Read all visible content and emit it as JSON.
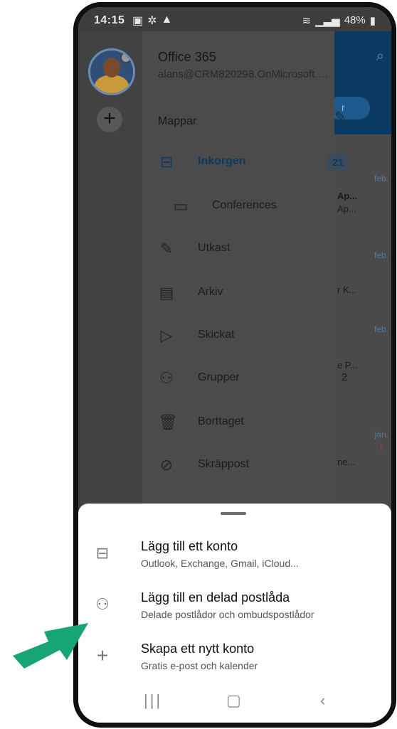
{
  "status": {
    "time": "14:15",
    "battery": "48%"
  },
  "account": {
    "name": "Office 365",
    "email": "alans@CRM820298.OnMicrosoft.c..."
  },
  "folders_header": "Mappar",
  "folders": [
    {
      "label": "Inkorgen",
      "icon": "inbox-icon",
      "badge": "21",
      "active": true
    },
    {
      "label": "Conferences",
      "icon": "folder-icon",
      "sub": true
    },
    {
      "label": "Utkast",
      "icon": "draft-icon"
    },
    {
      "label": "Arkiv",
      "icon": "archive-icon"
    },
    {
      "label": "Skickat",
      "icon": "send-icon"
    },
    {
      "label": "Grupper",
      "icon": "groups-icon",
      "count": "2"
    },
    {
      "label": "Borttaget",
      "icon": "trash-icon"
    },
    {
      "label": "Skräppost",
      "icon": "junk-icon"
    }
  ],
  "mail_peek": {
    "filter_label": "r",
    "rows": [
      {
        "date": "feb.",
        "text": "Ap...\nAp..."
      },
      {
        "date": "feb.",
        "text": ""
      },
      {
        "date": "",
        "text": "r K..."
      },
      {
        "date": "feb.",
        "text": ""
      },
      {
        "date": "",
        "text": "e P..."
      },
      {
        "date": "jan.",
        "text": "ne..."
      }
    ]
  },
  "sheet": {
    "options": [
      {
        "title": "Lägg till ett konto",
        "subtitle": "Outlook, Exchange, Gmail, iCloud..."
      },
      {
        "title": "Lägg till en delad postlåda",
        "subtitle": "Delade postlådor och ombudspostlådor"
      },
      {
        "title": "Skapa ett nytt konto",
        "subtitle": "Gratis e-post och kalender"
      }
    ]
  },
  "colors": {
    "arrow": "#17a673",
    "outlook_blue": "#0b3a63"
  }
}
